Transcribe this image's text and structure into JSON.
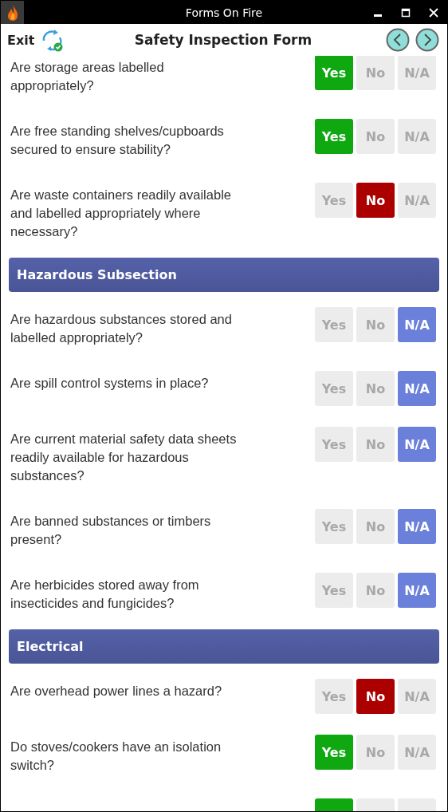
{
  "window": {
    "title": "Forms On Fire"
  },
  "header": {
    "exit": "Exit",
    "title": "Safety Inspection Form"
  },
  "sections": [
    {
      "questions": [
        {
          "text": "Are storage areas labelled appropriately?",
          "options": [
            {
              "kind": "yes",
              "label": "Yes",
              "selected": true
            },
            {
              "kind": "no",
              "label": "No",
              "selected": false
            },
            {
              "kind": "na",
              "label": "N/A",
              "selected": false
            }
          ]
        },
        {
          "text": "Are free standing shelves/cupboards secured to ensure stability?",
          "options": [
            {
              "kind": "yes",
              "label": "Yes",
              "selected": true
            },
            {
              "kind": "no",
              "label": "No",
              "selected": false
            },
            {
              "kind": "na",
              "label": "N/A",
              "selected": false
            }
          ]
        },
        {
          "text": "Are waste containers readily available and labelled appropriately where necessary?",
          "options": [
            {
              "kind": "yes",
              "label": "Yes",
              "selected": false
            },
            {
              "kind": "no",
              "label": "No",
              "selected": true
            },
            {
              "kind": "na",
              "label": "N/A",
              "selected": false
            }
          ]
        }
      ]
    },
    {
      "title": "Hazardous Subsection",
      "questions": [
        {
          "text": "Are hazardous substances stored and labelled appropriately?",
          "options": [
            {
              "kind": "yes",
              "label": "Yes",
              "selected": false
            },
            {
              "kind": "no",
              "label": "No",
              "selected": false
            },
            {
              "kind": "na",
              "label": "N/A",
              "selected": true
            }
          ]
        },
        {
          "text": "Are spill control systems in place?",
          "options": [
            {
              "kind": "yes",
              "label": "Yes",
              "selected": false
            },
            {
              "kind": "no",
              "label": "No",
              "selected": false
            },
            {
              "kind": "na",
              "label": "N/A",
              "selected": true
            }
          ]
        },
        {
          "text": "Are current material safety data sheets readily available for hazardous substances?",
          "options": [
            {
              "kind": "yes",
              "label": "Yes",
              "selected": false
            },
            {
              "kind": "no",
              "label": "No",
              "selected": false
            },
            {
              "kind": "na",
              "label": "N/A",
              "selected": true
            }
          ]
        },
        {
          "text": "Are banned substances or timbers present?",
          "options": [
            {
              "kind": "yes",
              "label": "Yes",
              "selected": false
            },
            {
              "kind": "no",
              "label": "No",
              "selected": false
            },
            {
              "kind": "na",
              "label": "N/A",
              "selected": true
            }
          ]
        },
        {
          "text": "Are herbicides stored away from insecticides and fungicides?",
          "options": [
            {
              "kind": "yes",
              "label": "Yes",
              "selected": false
            },
            {
              "kind": "no",
              "label": "No",
              "selected": false
            },
            {
              "kind": "na",
              "label": "N/A",
              "selected": true
            }
          ]
        }
      ]
    },
    {
      "title": "Electrical",
      "questions": [
        {
          "text": "Are overhead power lines a hazard?",
          "options": [
            {
              "kind": "yes",
              "label": "Yes",
              "selected": false
            },
            {
              "kind": "no",
              "label": "No",
              "selected": true
            },
            {
              "kind": "na",
              "label": "N/A",
              "selected": false
            }
          ]
        },
        {
          "text": "Do stoves/cookers have an isolation switch?",
          "options": [
            {
              "kind": "yes",
              "label": "Yes",
              "selected": true
            },
            {
              "kind": "no",
              "label": "No",
              "selected": false
            },
            {
              "kind": "na",
              "label": "N/A",
              "selected": false
            }
          ]
        }
      ]
    }
  ],
  "partial_row": {
    "options": [
      {
        "kind": "yes",
        "selected": true
      },
      {
        "kind": "no",
        "selected": false
      },
      {
        "kind": "na",
        "selected": false
      }
    ]
  }
}
